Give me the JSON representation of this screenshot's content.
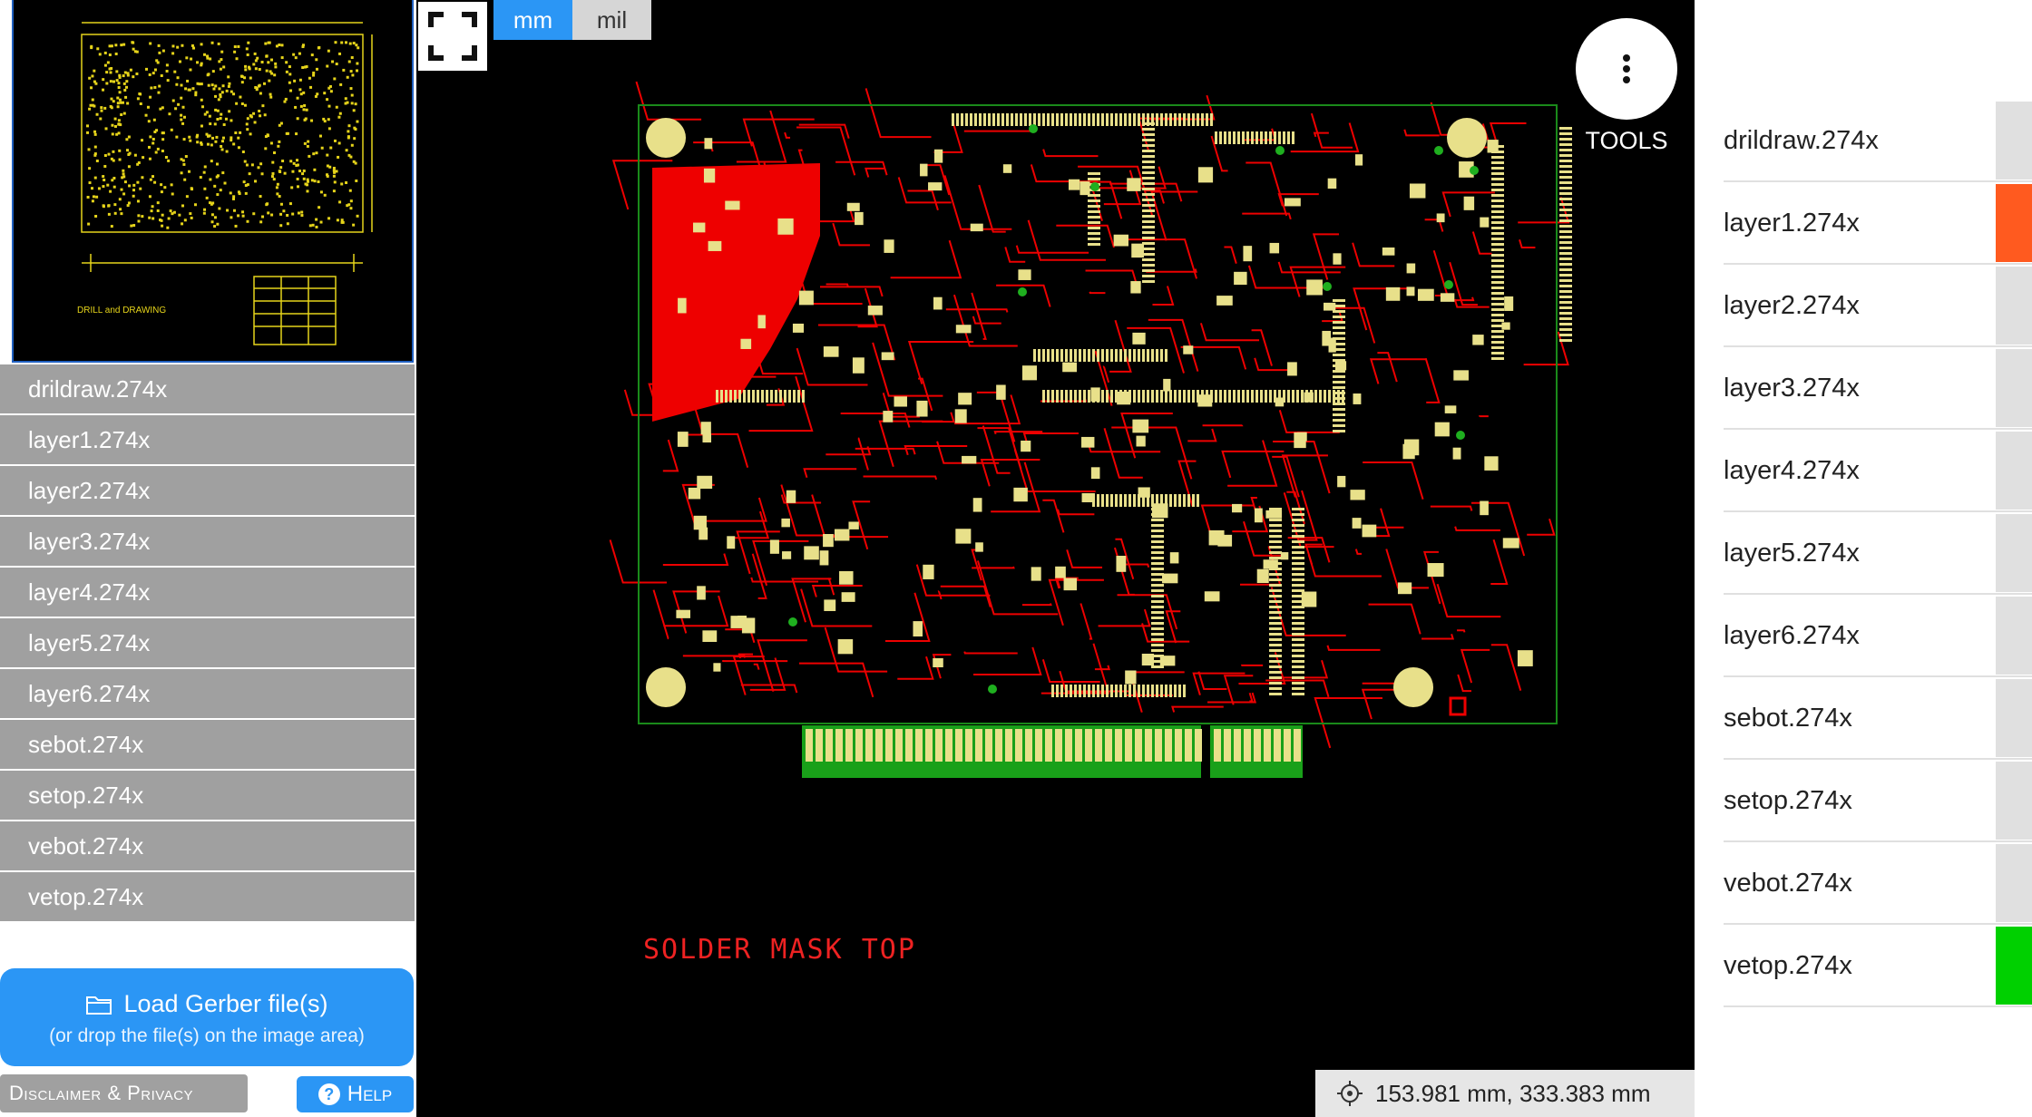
{
  "left_panel": {
    "thumbnail_title": "DRILL and DRAWING",
    "layers": [
      "drildraw.274x",
      "layer1.274x",
      "layer2.274x",
      "layer3.274x",
      "layer4.274x",
      "layer5.274x",
      "layer6.274x",
      "sebot.274x",
      "setop.274x",
      "vebot.274x",
      "vetop.274x"
    ],
    "load_button": {
      "label": "Load Gerber file(s)",
      "hint": "(or drop the file(s) on the image area)"
    },
    "disclaimer_label": "Disclaimer & Privacy",
    "help_label": "Help"
  },
  "viewer": {
    "units": {
      "active": "mm",
      "inactive": "mil"
    },
    "tools_label": "TOOLS",
    "coords": "153.981 mm, 333.383 mm",
    "overlap_label": "SOLDER MASK TOP",
    "icons": {
      "fullscreen": "fullscreen-icon",
      "tools": "more-vert-icon",
      "coords": "crosshair-icon",
      "folder": "folder-icon",
      "help": "help-icon"
    }
  },
  "right_panel": {
    "layers": [
      {
        "name": "drildraw.274x",
        "color": "#e0e0e0"
      },
      {
        "name": "layer1.274x",
        "color": "#ff5a1f"
      },
      {
        "name": "layer2.274x",
        "color": "#e0e0e0"
      },
      {
        "name": "layer3.274x",
        "color": "#e0e0e0"
      },
      {
        "name": "layer4.274x",
        "color": "#e0e0e0"
      },
      {
        "name": "layer5.274x",
        "color": "#e0e0e0"
      },
      {
        "name": "layer6.274x",
        "color": "#e0e0e0"
      },
      {
        "name": "sebot.274x",
        "color": "#e0e0e0"
      },
      {
        "name": "setop.274x",
        "color": "#e0e0e0"
      },
      {
        "name": "vebot.274x",
        "color": "#e0e0e0"
      },
      {
        "name": "vetop.274x",
        "color": "#00d000"
      }
    ]
  },
  "colors": {
    "accent": "#2b96f5",
    "copper": "#ee0000",
    "pad": "#e8e08a",
    "outline": "#1a8a1a",
    "thumb": "#e6d41a"
  }
}
